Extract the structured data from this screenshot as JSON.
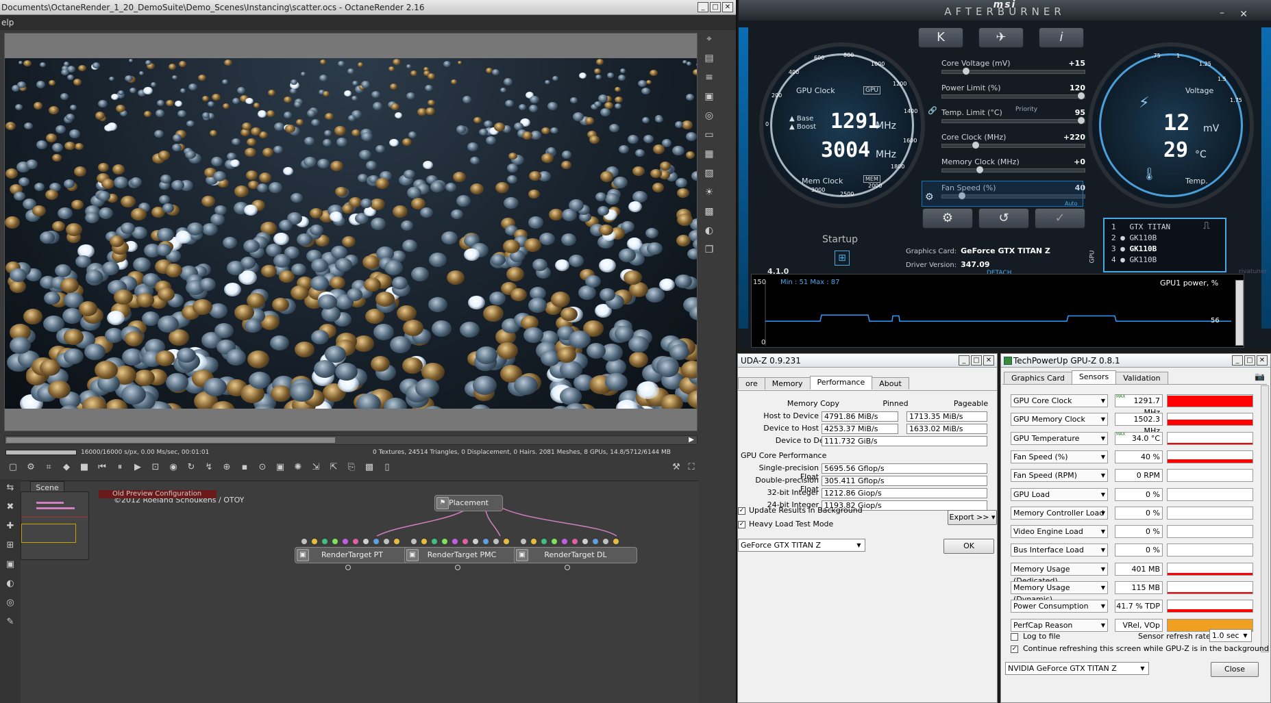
{
  "octane": {
    "title": "Documents\\OctaneRender_1_20_DemoSuite\\Demo_Scenes\\Instancing\\scatter.ocs - OctaneRender 2.16",
    "menu": "elp",
    "status_left": "16000/16000 s/px, 0.00 Ms/sec, 00:01:01",
    "status_right": "0 Textures, 24514 Triangles, 0 Displacement, 0 Hairs. 2081 Meshes, 8 GPUs, 14.8/5712/6144 MB",
    "render_progress": 1.0,
    "scene_tab": "Scene",
    "credit_title": "Old Preview Configuration",
    "credit": "©2012 Roeland Schoukens / OTOY",
    "nodes": {
      "placement": "Placement",
      "rt_pt": "RenderTarget PT",
      "rt_pmc": "RenderTarget PMC",
      "rt_dl": "RenderTarget DL"
    }
  },
  "afterburner": {
    "brand": "msi",
    "title": "AFTERBURNER",
    "buttons": {
      "k": "K",
      "plane": "✈",
      "info": "i"
    },
    "gpu_clock_label": "GPU Clock",
    "gpu_chip_label": "GPU",
    "base_label": "Base",
    "boost_label": "Boost",
    "gpu_clock": "1291",
    "gpu_clock_unit": "MHz",
    "mem_clock": "3004",
    "mem_clock_unit": "MHz",
    "mem_clock_label": "Mem Clock",
    "mem_chip_label": "MEM",
    "voltage_label": "Voltage",
    "voltage": "12",
    "voltage_unit": "mV",
    "temp": "29",
    "temp_unit": "°C",
    "temp_label": "Temp.",
    "priority_label": "Priority",
    "left_ticks": [
      "0",
      "200",
      "400",
      "600",
      "800",
      "1000",
      "1200",
      "1400",
      "1600",
      "1800",
      "2000",
      "2500",
      "3000"
    ],
    "right_ticks": [
      ".75",
      "1",
      "1.25",
      "1.5",
      "1.75"
    ],
    "sliders": [
      {
        "label": "Core Voltage (mV)",
        "value": "+15",
        "pos": 0.15
      },
      {
        "label": "Power Limit (%)",
        "value": "120",
        "pos": 1.0
      },
      {
        "label": "Temp. Limit (°C)",
        "value": "95",
        "pos": 1.0
      },
      {
        "label": "Core Clock (MHz)",
        "value": "+220",
        "pos": 0.22
      },
      {
        "label": "Memory Clock (MHz)",
        "value": "+0",
        "pos": 0.25
      },
      {
        "label": "Fan Speed (%)",
        "value": "40",
        "pos": 0.12
      }
    ],
    "auto_label": "Auto",
    "startup_label": "Startup",
    "graphics_card_label": "Graphics Card:",
    "graphics_card": "GeForce GTX TITAN Z",
    "driver_label": "Driver Version:",
    "driver": "347.09",
    "detach": "DETACH",
    "version": "4.1.0",
    "gpu_list": [
      {
        "idx": "1",
        "name": "GTX TITAN"
      },
      {
        "idx": "2",
        "name": "GK110B"
      },
      {
        "idx": "3",
        "name": "GK110B"
      },
      {
        "idx": "4",
        "name": "GK110B"
      }
    ],
    "graph": {
      "ymax": "150",
      "ymin": "0",
      "minmax": "Min : 51   Max : 87",
      "title": "GPU1 power, %",
      "current": "56"
    },
    "side_label": "GPU",
    "brand_right": "rivatuner"
  },
  "cudaz": {
    "title": "UDA-Z 0.9.231",
    "tabs": [
      "ore",
      "Memory",
      "Performance",
      "About"
    ],
    "active_tab": "Performance",
    "col_pinned": "Pinned",
    "col_pageable": "Pageable",
    "memory_copy": "Memory Copy",
    "rows": [
      {
        "label": "Host to Device",
        "pinned": "4791.86 MiB/s",
        "pageable": "1713.35 MiB/s"
      },
      {
        "label": "Device to Host",
        "pinned": "4253.37 MiB/s",
        "pageable": "1633.02 MiB/s"
      }
    ],
    "d2d_label": "Device to Device",
    "d2d": "111.732 GiB/s",
    "core_perf": "GPU Core Performance",
    "perf": [
      {
        "label": "Single-precision Float",
        "value": "5695.56 Gflop/s"
      },
      {
        "label": "Double-precision Float",
        "value": "305.411 Gflop/s"
      },
      {
        "label": "32-bit Integer",
        "value": "1212.86 Giop/s"
      },
      {
        "label": "24-bit Integer",
        "value": "1193.82 Giop/s"
      }
    ],
    "update_bg": "Update Results in Background",
    "heavy_load": "Heavy Load Test Mode",
    "export": "Export >>",
    "device": "GeForce GTX TITAN Z",
    "ok": "OK"
  },
  "gpuz": {
    "title": "TechPowerUp GPU-Z 0.8.1",
    "tabs": [
      "Graphics Card",
      "Sensors",
      "Validation"
    ],
    "active_tab": "Sensors",
    "max_label": "MAX",
    "sensors": [
      {
        "name": "GPU Core Clock",
        "value": "1291.7 MHz",
        "level": 0.95,
        "color": "#ff0000"
      },
      {
        "name": "GPU Memory Clock",
        "value": "1502.3 MHz",
        "level": 0.45,
        "color": "#ff0000"
      },
      {
        "name": "GPU Temperature",
        "value": "34.0 °C",
        "level": 0.1,
        "color": "#ff0000"
      },
      {
        "name": "Fan Speed (%)",
        "value": "40 %",
        "level": 0.3,
        "color": "#ff0000"
      },
      {
        "name": "Fan Speed (RPM)",
        "value": "0 RPM",
        "level": 0,
        "color": "#ff0000"
      },
      {
        "name": "GPU Load",
        "value": "0 %",
        "level": 0,
        "color": "#ff0000"
      },
      {
        "name": "Memory Controller Load",
        "value": "0 %",
        "level": 0,
        "color": "#ff0000"
      },
      {
        "name": "Video Engine Load",
        "value": "0 %",
        "level": 0,
        "color": "#ff0000"
      },
      {
        "name": "Bus Interface Load",
        "value": "0 %",
        "level": 0,
        "color": "#ff0000"
      },
      {
        "name": "Memory Usage (Dedicated)",
        "value": "401 MB",
        "level": 0.15,
        "color": "#ff0000"
      },
      {
        "name": "Memory Usage (Dynamic)",
        "value": "115 MB",
        "level": 0.1,
        "color": "#ff0000"
      },
      {
        "name": "Power Consumption",
        "value": "41.7 % TDP",
        "level": 0.25,
        "color": "#ff0000"
      },
      {
        "name": "PerfCap Reason",
        "value": "VRel, VOp",
        "level": 1.0,
        "color": "#f0a020"
      }
    ],
    "log_to_file": "Log to file",
    "refresh_label": "Sensor refresh rate:",
    "refresh": "1.0 sec",
    "continue": "Continue refreshing this screen while GPU-Z is in the background",
    "device": "NVIDIA GeForce GTX TITAN Z",
    "close": "Close"
  }
}
